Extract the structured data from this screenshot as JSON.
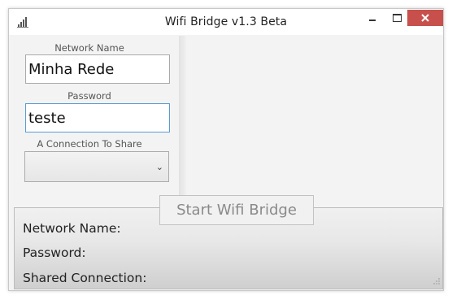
{
  "window": {
    "title": "Wifi Bridge v1.3 Beta",
    "app_icon": "signal-bars-icon",
    "controls": {
      "minimize": "minimize-icon",
      "maximize": "maximize-icon",
      "close": "close-icon"
    },
    "close_color": "#c7504c"
  },
  "form": {
    "network_name_label": "Network Name",
    "network_name_value": "Minha Rede",
    "password_label": "Password",
    "password_value": "teste",
    "connection_label": "A Connection To Share",
    "connection_selected": ""
  },
  "action": {
    "start_label": "Start Wifi Bridge"
  },
  "status": {
    "network_name_label": "Network Name:",
    "password_label": "Password:",
    "shared_connection_label": "Shared Connection:"
  }
}
